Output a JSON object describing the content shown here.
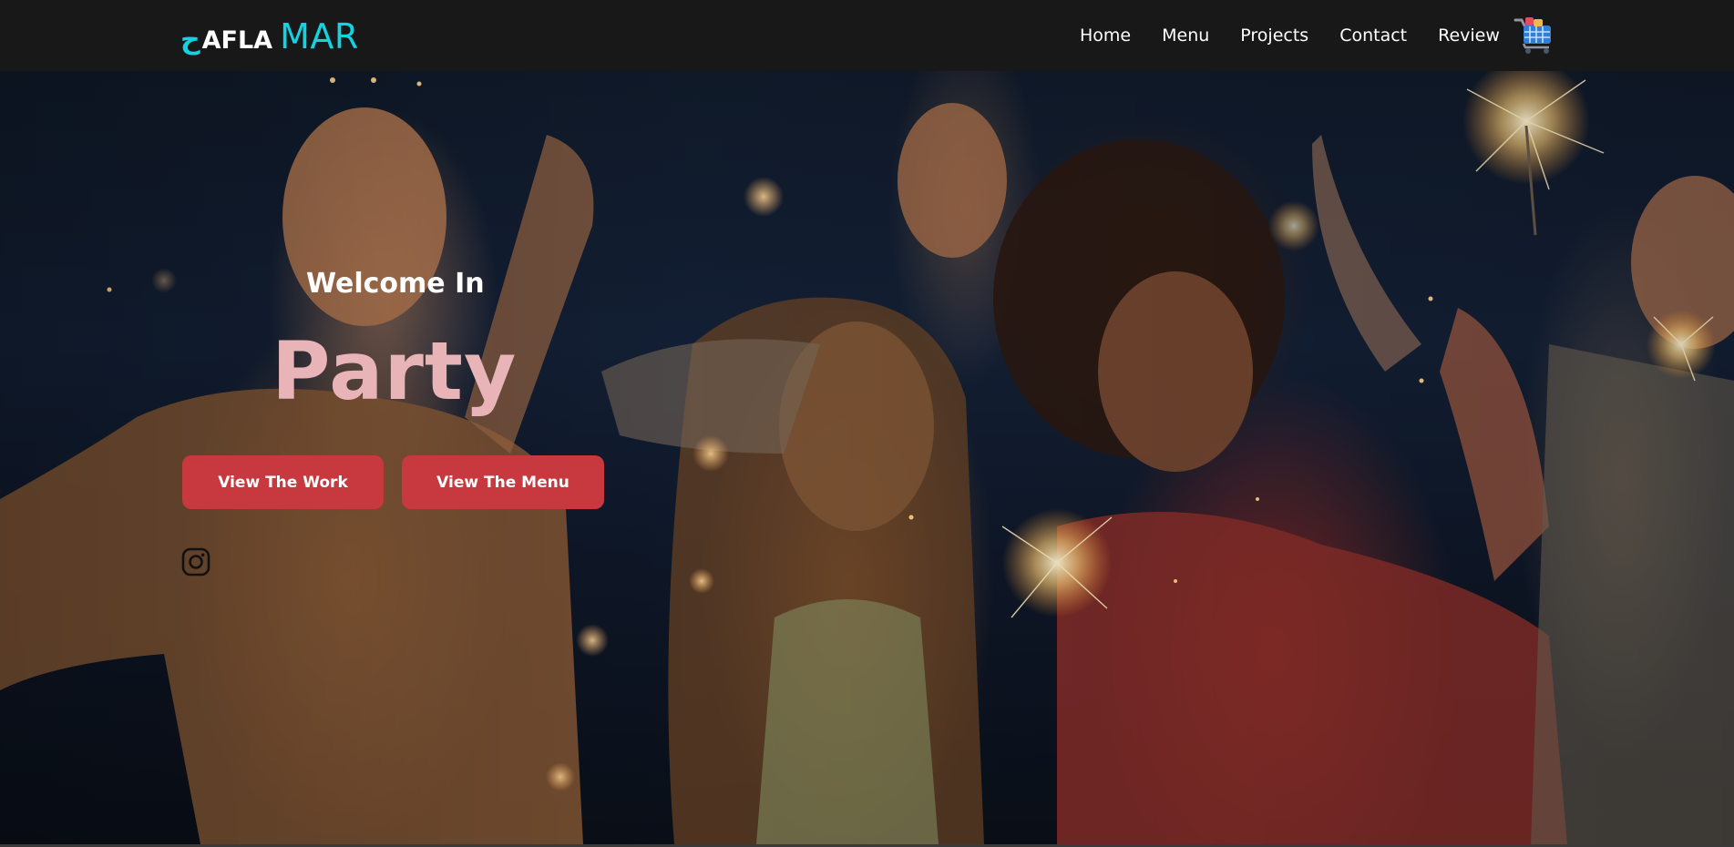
{
  "navbar": {
    "logo": {
      "arabic": "ح",
      "afla": "AFLA",
      "mar": "MAR"
    },
    "links": [
      "Home",
      "Menu",
      "Projects",
      "Contact",
      "Review"
    ],
    "cart_icon": "shopping-cart-icon"
  },
  "hero": {
    "welcome": "Welcome In",
    "title": "Party",
    "buttons": {
      "work": "View The Work",
      "menu": "View The Menu"
    },
    "social_icon": "instagram-icon"
  },
  "colors": {
    "navbar_bg": "#181818",
    "logo_accent": "#13d3e0",
    "title_pink": "#e8b4b8",
    "button_red": "#c8393f"
  }
}
